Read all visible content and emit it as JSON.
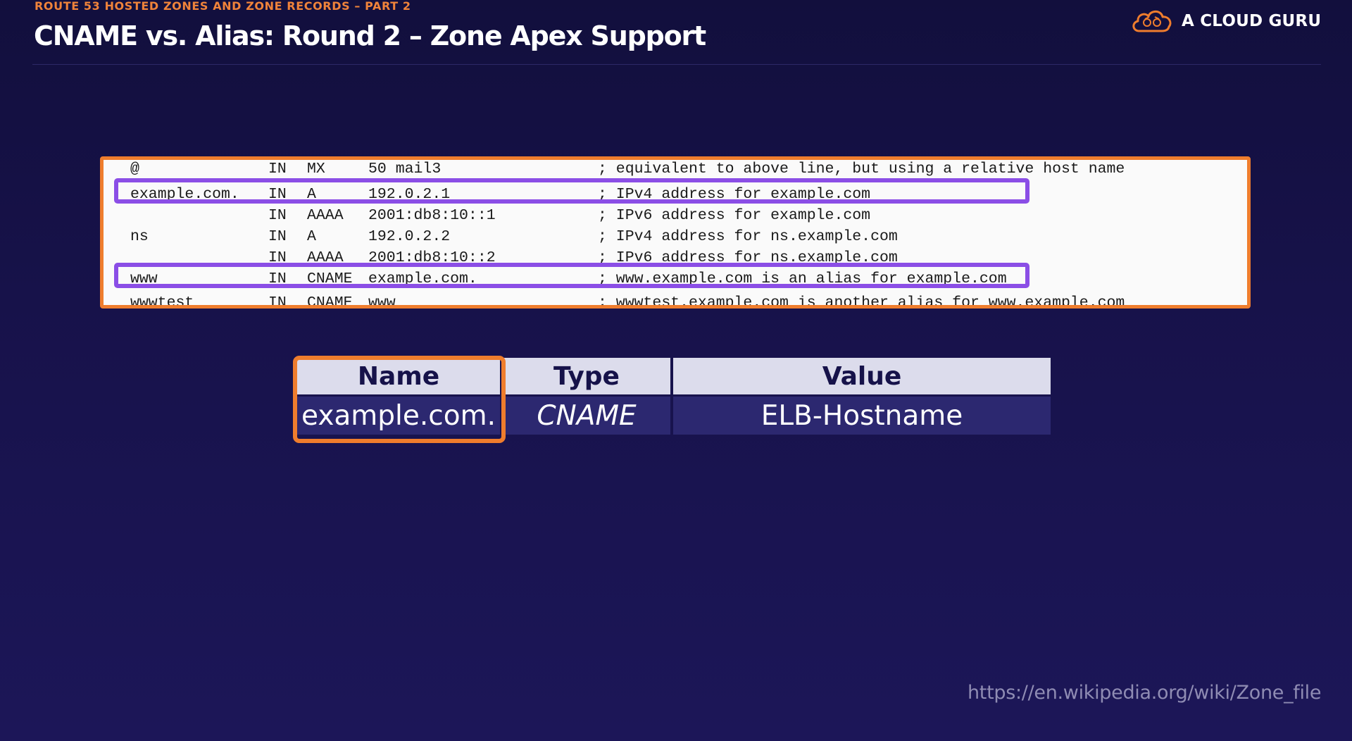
{
  "header": {
    "subtitle": "ROUTE 53 HOSTED ZONES AND ZONE RECORDS – PART 2",
    "title": "CNAME vs. Alias: Round 2 – Zone Apex Support"
  },
  "logo": {
    "icon": "cloud-icon",
    "text": "A CLOUD GURU"
  },
  "zone_file": {
    "lines": [
      {
        "host": "@",
        "class": "IN",
        "type": "MX",
        "value": "50 mail3",
        "comment": "; equivalent to above line, but using a relative host name"
      },
      {
        "host": "example.com.",
        "class": "IN",
        "type": "A",
        "value": "192.0.2.1",
        "comment": "; IPv4 address for example.com"
      },
      {
        "host": "",
        "class": "IN",
        "type": "AAAA",
        "value": "2001:db8:10::1",
        "comment": "; IPv6 address for example.com"
      },
      {
        "host": "ns",
        "class": "IN",
        "type": "A",
        "value": "192.0.2.2",
        "comment": "; IPv4 address for ns.example.com"
      },
      {
        "host": "",
        "class": "IN",
        "type": "AAAA",
        "value": "2001:db8:10::2",
        "comment": "; IPv6 address for ns.example.com"
      },
      {
        "host": "www",
        "class": "IN",
        "type": "CNAME",
        "value": "example.com.",
        "comment": "; www.example.com is an alias for example.com"
      },
      {
        "host": "wwwtest",
        "class": "IN",
        "type": "CNAME",
        "value": "www",
        "comment": "; wwwtest.example.com is another alias for www.example.com"
      }
    ]
  },
  "record_table": {
    "headers": [
      "Name",
      "Type",
      "Value"
    ],
    "row": [
      "example.com.",
      "CNAME",
      "ELB-Hostname"
    ]
  },
  "source": "https://en.wikipedia.org/wiki/Zone_file",
  "colors": {
    "accent_orange": "#ef7d2d",
    "highlight_purple": "#8b4ee6",
    "background": "#17124a"
  }
}
